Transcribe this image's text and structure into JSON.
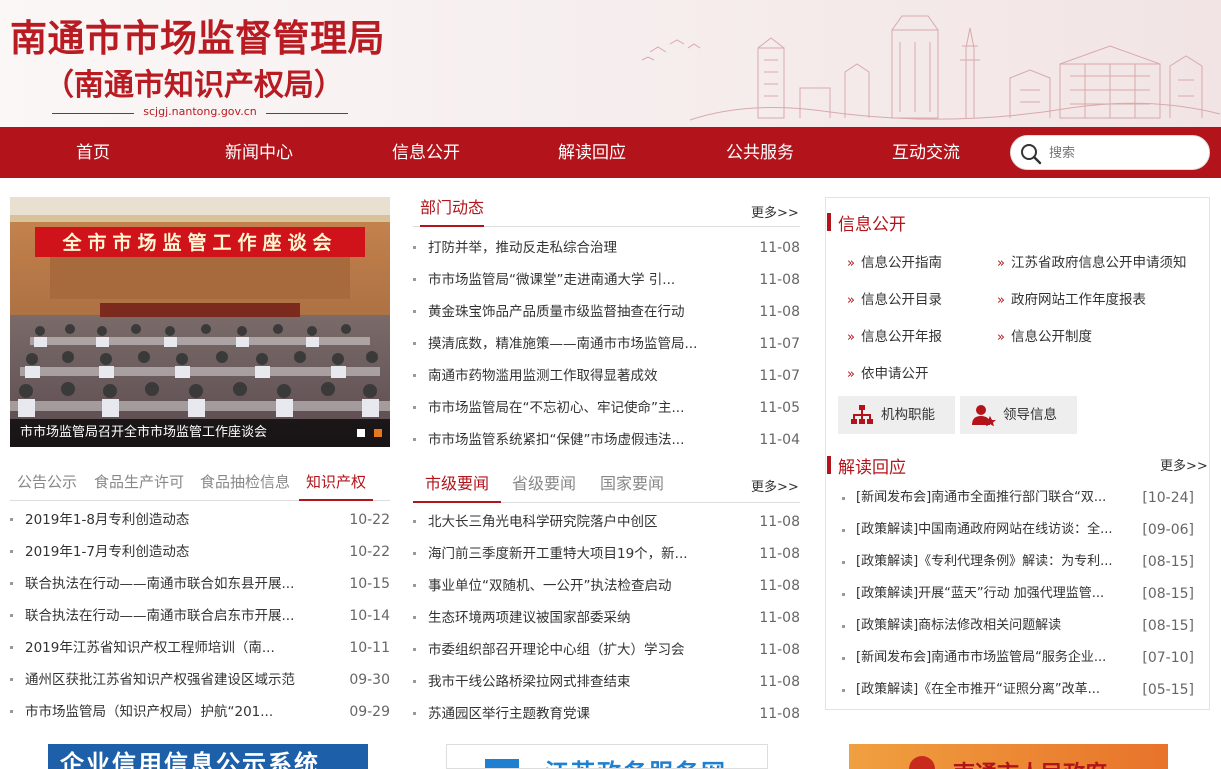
{
  "header": {
    "title": "南通市市场监督管理局",
    "subtitle": "（南通市知识产权局）",
    "domain": "scjgj.nantong.gov.cn"
  },
  "nav": {
    "items": [
      "首页",
      "新闻中心",
      "信息公开",
      "解读回应",
      "公共服务",
      "互动交流"
    ],
    "search_placeholder": "搜索"
  },
  "slideshow": {
    "banner_text": "全市市场监管工作座谈会",
    "caption": "市市场监管局召开全市市场监管工作座谈会"
  },
  "dept_news": {
    "tab": "部门动态",
    "more": "更多>>",
    "items": [
      {
        "title": "打防并举，推动反走私综合治理",
        "date": "11-08"
      },
      {
        "title": "市市场监管局“微课堂”走进南通大学 引...",
        "date": "11-08"
      },
      {
        "title": "黄金珠宝饰品产品质量市级监督抽查在行动",
        "date": "11-08"
      },
      {
        "title": "摸清底数，精准施策——南通市市场监管局...",
        "date": "11-07"
      },
      {
        "title": "南通市药物滥用监测工作取得显著成效",
        "date": "11-07"
      },
      {
        "title": "市市场监管局在“不忘初心、牢记使命”主...",
        "date": "11-05"
      },
      {
        "title": "市市场监管系统紧扣“保健”市场虚假违法...",
        "date": "11-04"
      }
    ]
  },
  "left_tabs": {
    "tabs": [
      "公告公示",
      "食品生产许可",
      "食品抽检信息",
      "知识产权"
    ],
    "active": 3,
    "items": [
      {
        "title": "2019年1-8月专利创造动态",
        "date": "10-22"
      },
      {
        "title": "2019年1-7月专利创造动态",
        "date": "10-22"
      },
      {
        "title": "联合执法在行动——南通市联合如东县开展...",
        "date": "10-15"
      },
      {
        "title": "联合执法在行动——南通市联合启东市开展...",
        "date": "10-14"
      },
      {
        "title": "2019年江苏省知识产权工程师培训（南...",
        "date": "10-11"
      },
      {
        "title": "通州区获批江苏省知识产权强省建设区域示范",
        "date": "09-30"
      },
      {
        "title": "市市场监管局（知识产权局）护航“201...",
        "date": "09-29"
      }
    ]
  },
  "mid_tabs": {
    "tabs": [
      "市级要闻",
      "省级要闻",
      "国家要闻"
    ],
    "active": 0,
    "more": "更多>>",
    "items": [
      {
        "title": "北大长三角光电科学研究院落户中创区",
        "date": "11-08"
      },
      {
        "title": "海门前三季度新开工重特大项目19个，新...",
        "date": "11-08"
      },
      {
        "title": "事业单位“双随机、一公开”执法检查启动",
        "date": "11-08"
      },
      {
        "title": "生态环境两项建议被国家部委采纳",
        "date": "11-08"
      },
      {
        "title": "市委组织部召开理论中心组（扩大）学习会",
        "date": "11-08"
      },
      {
        "title": "我市干线公路桥梁拉网式排查结束",
        "date": "11-08"
      },
      {
        "title": "苏通园区举行主题教育党课",
        "date": "11-08"
      }
    ]
  },
  "info_open": {
    "heading": "信息公开",
    "links_left": [
      "信息公开指南",
      "信息公开目录",
      "信息公开年报",
      "依申请公开"
    ],
    "links_right": [
      "江苏省政府信息公开申请须知",
      "政府网站工作年度报表",
      "信息公开制度"
    ],
    "buttons": [
      "机构职能",
      "领导信息"
    ]
  },
  "jiedu": {
    "heading": "解读回应",
    "more": "更多>>",
    "items": [
      {
        "title": "[新闻发布会]南通市全面推行部门联合“双...",
        "date": "[10-24]"
      },
      {
        "title": "[政策解读]中国南通政府网站在线访谈：全...",
        "date": "[09-06]"
      },
      {
        "title": "[政策解读]《专利代理条例》解读：为专利...",
        "date": "[08-15]"
      },
      {
        "title": "[政策解读]开展“蓝天”行动 加强代理监管...",
        "date": "[08-15]"
      },
      {
        "title": "[政策解读]商标法修改相关问题解读",
        "date": "[08-15]"
      },
      {
        "title": "[新闻发布会]南通市市场监管局“服务企业...",
        "date": "[07-10]"
      },
      {
        "title": "[政策解读]《在全市推开“证照分离”改革...",
        "date": "[05-15]"
      }
    ]
  },
  "banners": [
    "企业信用信息公示系统",
    "江苏政务服务网",
    "南通市人民政府"
  ],
  "colors": {
    "brand": "#b3141b",
    "title": "#b81c22"
  }
}
